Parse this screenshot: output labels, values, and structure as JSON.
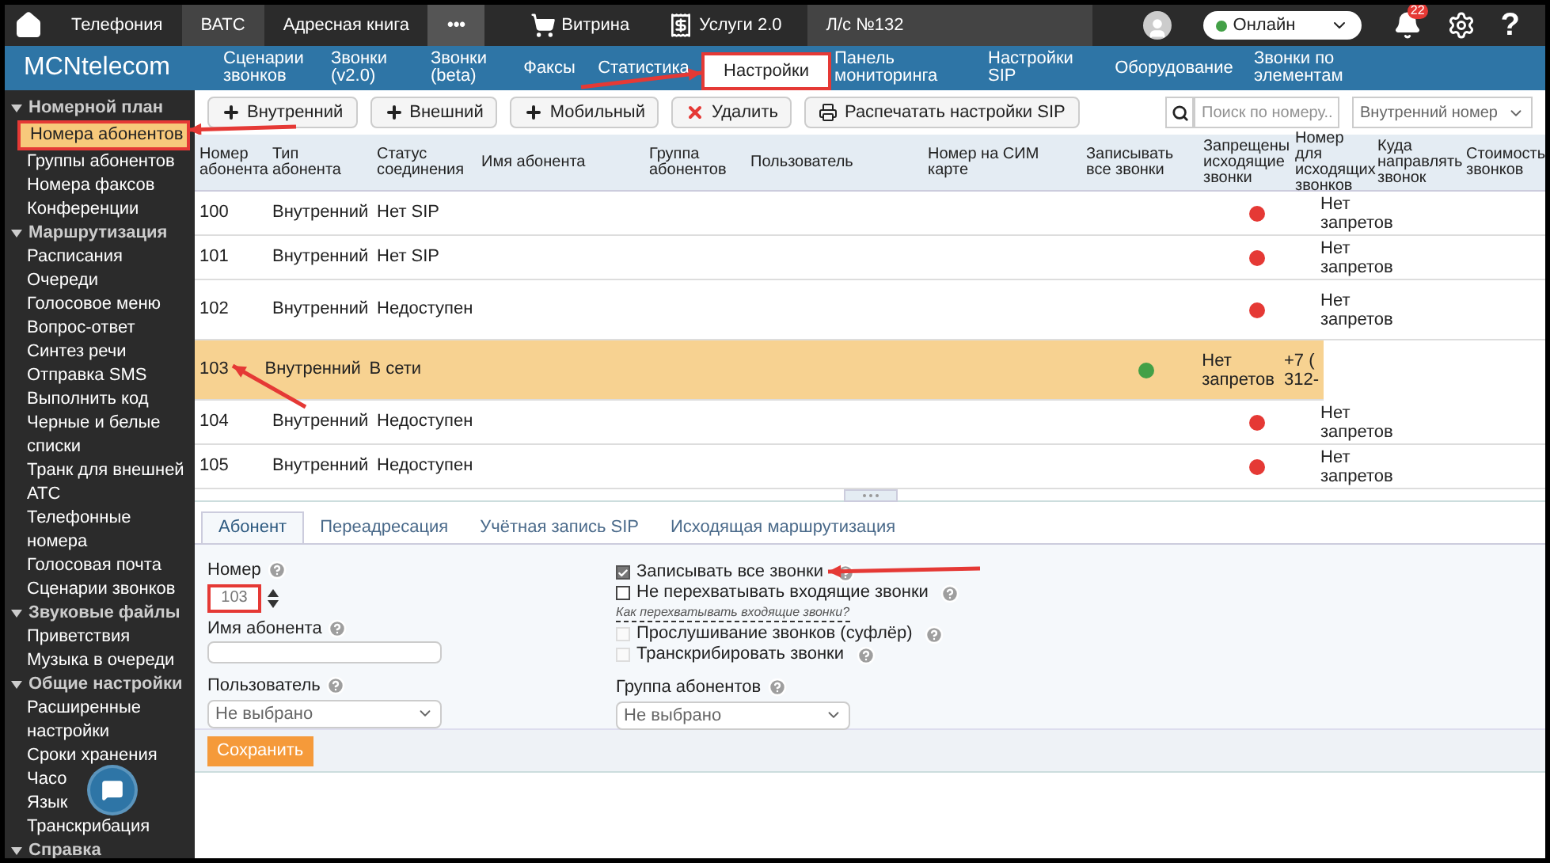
{
  "topbar": {
    "items": [
      {
        "label": "Телефония",
        "selected": false
      },
      {
        "label": "ВАТС",
        "selected": true
      },
      {
        "label": "Адресная книга",
        "selected": false
      }
    ],
    "more": "•••",
    "shop": "Витрина",
    "services": "Услуги 2.0",
    "account": "Л/с №132",
    "status": "Онлайн",
    "notifications": "22",
    "help": "?"
  },
  "logo": "MCNtelecom",
  "nav": [
    {
      "label": "Сценарии звонков",
      "selected": false
    },
    {
      "label": "Звонки (v2.0)",
      "selected": false
    },
    {
      "label": "Звонки (beta)",
      "selected": false
    },
    {
      "label": "Факсы",
      "selected": false
    },
    {
      "label": "Статистика",
      "selected": false
    },
    {
      "label": "Настройки",
      "selected": true
    },
    {
      "label": "Панель мониторинга",
      "selected": false
    },
    {
      "label": "Настройки SIP",
      "selected": false
    },
    {
      "label": "Оборудование",
      "selected": false
    },
    {
      "label": "Звонки по элементам",
      "selected": false
    }
  ],
  "sidebar": [
    {
      "label": "Номерной план",
      "expanded": true,
      "children": [
        {
          "label": "Номера абонентов",
          "selected": true
        },
        {
          "label": "Группы абонентов",
          "selected": false
        },
        {
          "label": "Номера факсов",
          "selected": false
        },
        {
          "label": "Конференции",
          "selected": false
        }
      ]
    },
    {
      "label": "Маршрутизация",
      "expanded": true,
      "children": [
        {
          "label": "Расписания",
          "selected": false
        },
        {
          "label": "Очереди",
          "selected": false
        },
        {
          "label": "Голосовое меню",
          "selected": false
        },
        {
          "label": "Вопрос-ответ",
          "selected": false
        },
        {
          "label": "Синтез речи",
          "selected": false
        },
        {
          "label": "Отправка SMS",
          "selected": false
        },
        {
          "label": "Выполнить код",
          "selected": false
        },
        {
          "label": "Черные и белые списки",
          "selected": false
        },
        {
          "label": "Транк для внешней АТС",
          "selected": false
        },
        {
          "label": "Телефонные номера",
          "selected": false
        },
        {
          "label": "Голосовая почта",
          "selected": false
        },
        {
          "label": "Сценарии звонков",
          "selected": false
        }
      ]
    },
    {
      "label": "Звуковые файлы",
      "expanded": true,
      "children": [
        {
          "label": "Приветствия",
          "selected": false
        },
        {
          "label": "Музыка в очереди",
          "selected": false
        }
      ]
    },
    {
      "label": "Общие настройки",
      "expanded": true,
      "children": [
        {
          "label": "Расширенные настройки",
          "selected": false
        },
        {
          "label": "Сроки хранения",
          "selected": false
        },
        {
          "label": "Часо",
          "selected": false
        },
        {
          "label": "Язык",
          "selected": false
        },
        {
          "label": "Транскрибация",
          "selected": false
        }
      ]
    },
    {
      "label": "Справка",
      "expanded": true
    }
  ],
  "toolbar": {
    "buttons": [
      {
        "kind": "add",
        "label": "Внутренний"
      },
      {
        "kind": "add",
        "label": "Внешний"
      },
      {
        "kind": "add",
        "label": "Мобильный"
      },
      {
        "kind": "delete",
        "label": "Удалить"
      },
      {
        "kind": "print",
        "label": "Распечатать настройки SIP"
      }
    ],
    "search": {
      "placeholder": "Поиск по номеру.."
    },
    "filter": "Внутренний номер"
  },
  "table": {
    "columns": [
      "Номер абонента",
      "Тип абонента",
      "Статус соединения",
      "Имя абонента",
      "Группа абонентов",
      "Пользователь",
      "Номер на СИМ карте",
      "Записывать все звонки",
      "Запрещены исходящие звонки",
      "Номер для исходящих звонков",
      "Куда направлять звонок",
      "Стоимость звонков"
    ],
    "rows": [
      {
        "number": "100",
        "type": "Внутренний",
        "status": "Нет SIP",
        "color": "#e53935",
        "restrictions": "Нет запретов",
        "selected": false
      },
      {
        "number": "101",
        "type": "Внутренний",
        "status": "Нет SIP",
        "color": "#e53935",
        "restrictions": "Нет запретов",
        "selected": false
      },
      {
        "number": "102",
        "type": "Внутренний",
        "status": "Недоступен",
        "color": "#e53935",
        "restrictions": "Нет запретов",
        "selected": false
      },
      {
        "number": "103",
        "type": "Внутренний",
        "status": "В сети",
        "color": "#43a047",
        "restrictions": "Нет запретов",
        "outgoing": "+7 (",
        "outgoing_2": "312-",
        "selected": true
      },
      {
        "number": "104",
        "type": "Внутренний",
        "status": "Недоступен",
        "color": "#e53935",
        "restrictions": "Нет запретов",
        "selected": false
      },
      {
        "number": "105",
        "type": "Внутренний",
        "status": "Недоступен",
        "color": "#e53935",
        "restrictions": "Нет запретов",
        "selected": false
      }
    ]
  },
  "detail": {
    "tabs": [
      {
        "label": "Абонент",
        "selected": true
      },
      {
        "label": "Переадресация",
        "selected": false
      },
      {
        "label": "Учётная запись SIP",
        "selected": false
      },
      {
        "label": "Исходящая маршрутизация",
        "selected": false
      }
    ],
    "number_label": "Номер",
    "number": "103",
    "name_label": "Имя абонента",
    "user_label": "Пользователь",
    "user_value": "Не выбрано",
    "options": [
      {
        "kind": "checkbox",
        "label": "Записывать все звонки",
        "checked": true,
        "disabled": false
      },
      {
        "kind": "checkbox",
        "label": "Не перехватывать входящие звонки",
        "checked": false,
        "disabled": false
      },
      {
        "kind": "link",
        "label": "Как перехватывать входящие звонки?"
      },
      {
        "kind": "checkbox",
        "label": "Прослушивание звонков (суфлёр)",
        "checked": false,
        "disabled": true
      },
      {
        "kind": "checkbox",
        "label": "Транскрибировать звонки",
        "checked": false,
        "disabled": true
      }
    ],
    "group_label": "Группа абонентов",
    "group_value": "Не выбрано",
    "save": "Сохранить"
  }
}
